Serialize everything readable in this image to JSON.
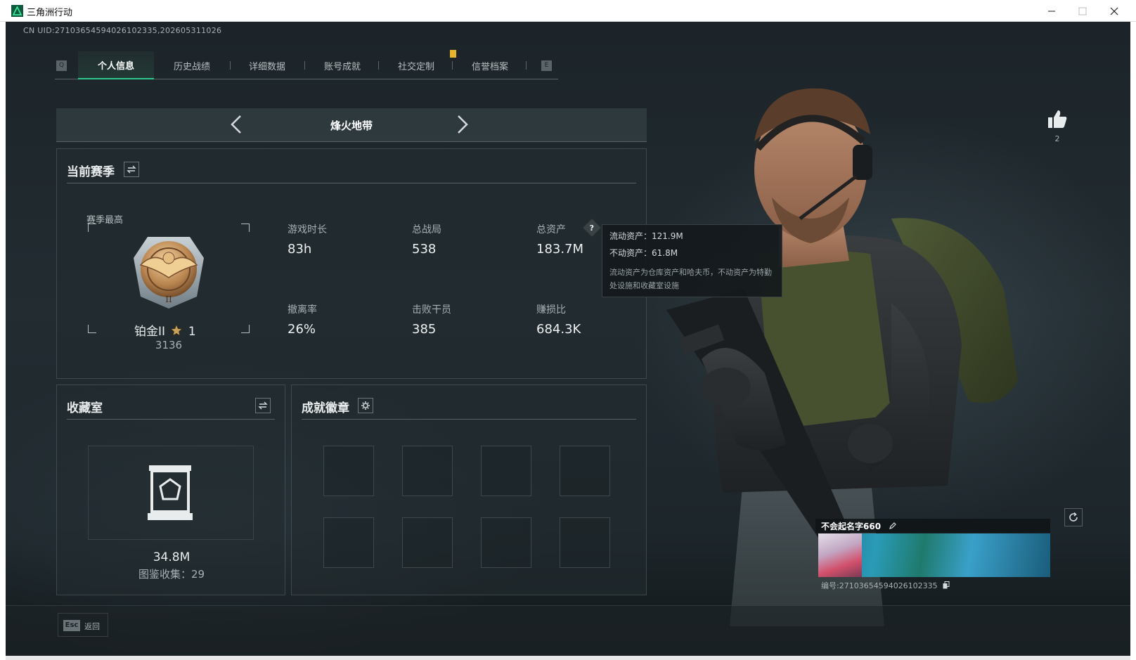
{
  "window": {
    "title": "三角洲行动"
  },
  "header": {
    "uid": "CN UID:2710365459402610233​5,202605311026",
    "watermark": "",
    "tab_key_left": "Q",
    "tab_key_right": "E"
  },
  "tabs": [
    {
      "label": "个人信息",
      "active": true
    },
    {
      "label": "历史战绩",
      "active": false
    },
    {
      "label": "详细数据",
      "active": false
    },
    {
      "label": "账号成就",
      "active": false
    },
    {
      "label": "社交定制",
      "active": false
    },
    {
      "label": "信誉档案",
      "active": false
    }
  ],
  "map_selector": {
    "name": "烽火地带"
  },
  "season": {
    "title": "当前赛季",
    "best_label": "赛季最高",
    "rank_name": "铂金II",
    "rank_stars": "1",
    "rank_score": "3136",
    "stats": [
      {
        "label": "游戏时长",
        "value": "83h"
      },
      {
        "label": "总战局",
        "value": "538"
      },
      {
        "label": "总资产",
        "value": "183.7M"
      },
      {
        "label": "撤离率",
        "value": "26%"
      },
      {
        "label": "击败干员",
        "value": "385"
      },
      {
        "label": "赚损比",
        "value": "684.3K"
      }
    ]
  },
  "tooltip": {
    "liquid": "流动资产：121.9M",
    "fixed": "不动资产：61.8M",
    "desc": "流动资产为仓库资产和哈夫币，不动资产为特勤处设施和收藏室设施"
  },
  "collection": {
    "title": "收藏室",
    "value": "34.8M",
    "gallery": "图鉴收集：29"
  },
  "achievements": {
    "title": "成就徽章"
  },
  "profile": {
    "likes": "2",
    "player_name": "不会起名字660",
    "player_id": "编号:2710365459402610233​5"
  },
  "footer": {
    "esc_key": "Esc",
    "back_label": "返回"
  },
  "colors": {
    "accent": "#2bc78b",
    "notify": "#e6b52d"
  }
}
